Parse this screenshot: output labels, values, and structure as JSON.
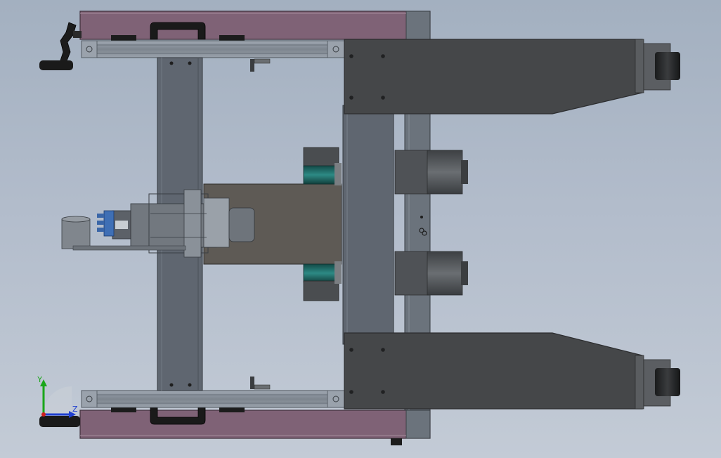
{
  "view": {
    "background_top": "#a3b0c0",
    "background_bottom": "#c3cbd6"
  },
  "colors": {
    "purple_frame": "#7f6276",
    "purple_frame_edge": "#5a4553",
    "aluminum_rail": "#8f98a3",
    "aluminum_dark": "#6b737c",
    "steel_gray": "#5f6670",
    "dark_arm": "#454749",
    "dark_arm_edge": "#2c2d2f",
    "motor": "#505356",
    "teal_coupling": "#1f6e6a",
    "belt_panel": "#5e5a55",
    "blue_connector": "#3f6fb5",
    "axis_y": "#1aa61a",
    "axis_z": "#1f3fd0",
    "axis_x": "#d01f1f"
  },
  "triad": {
    "y_label": "Y",
    "z_label": "Z"
  },
  "icons": {
    "triad": "coordinate-triad-icon",
    "crank": "hand-crank-icon",
    "handle": "grip-handle-icon"
  }
}
